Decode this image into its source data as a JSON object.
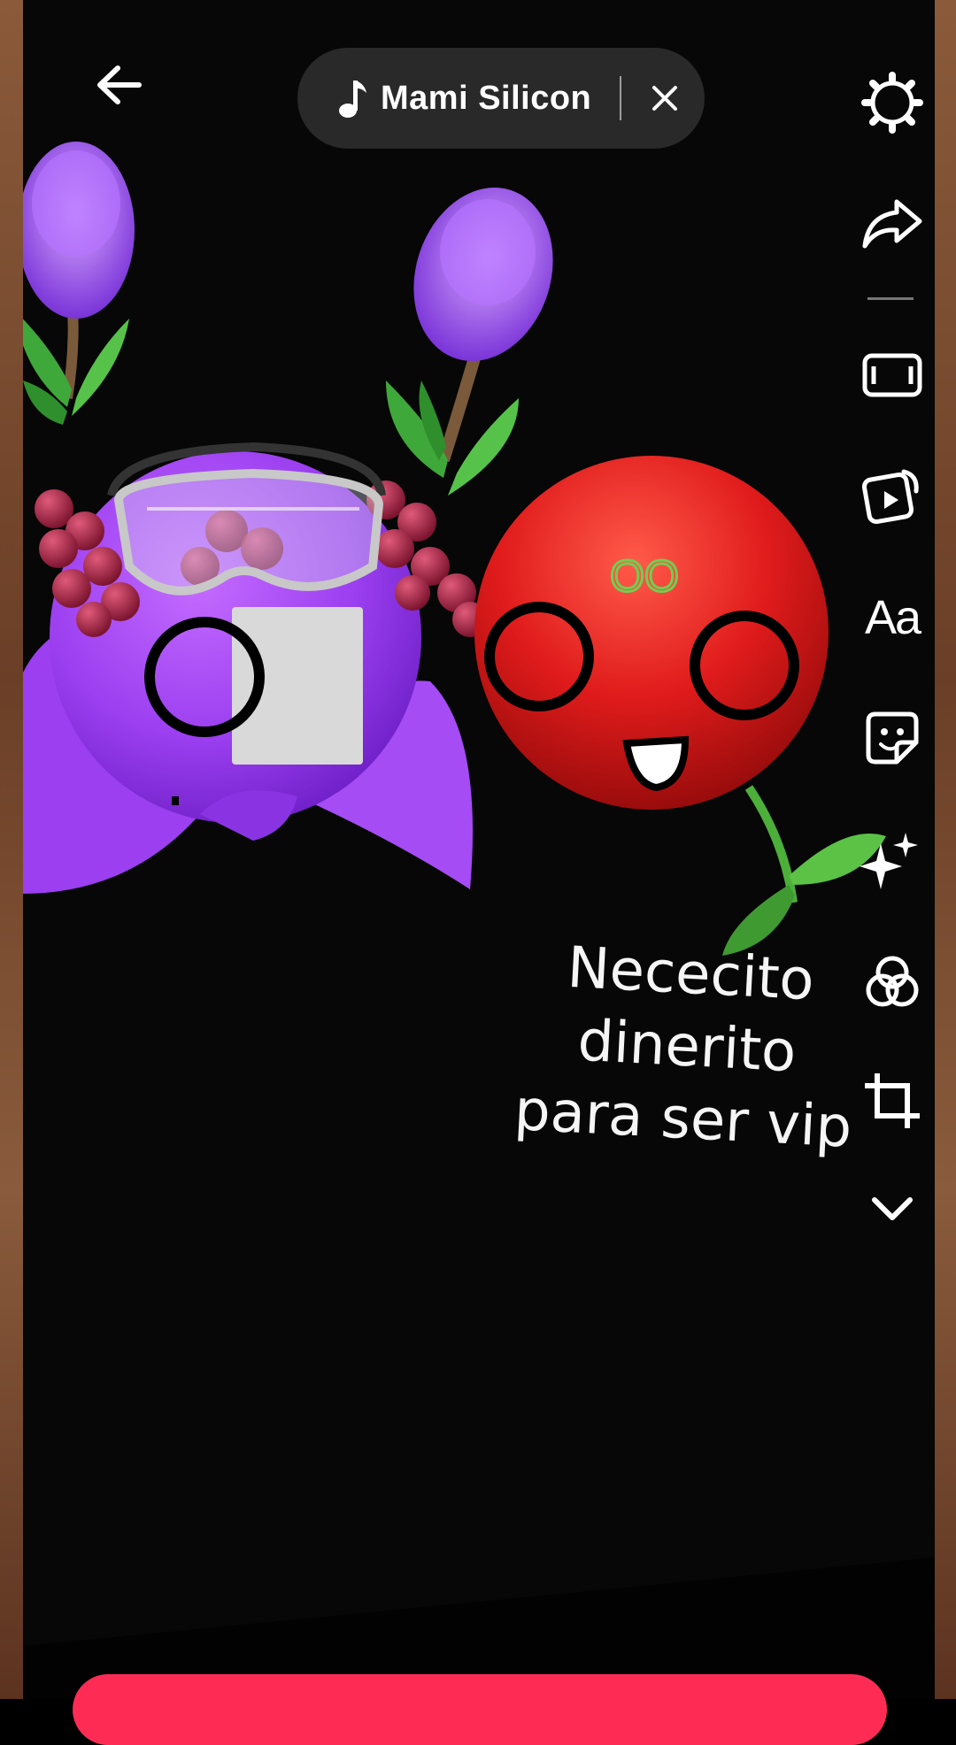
{
  "header": {
    "sound_title": "Mami Silicon"
  },
  "toolbar": {
    "text_tool_label": "Aa",
    "items": [
      "settings-icon",
      "share-arrow-icon",
      "screen-icon",
      "template-icon",
      "text-icon",
      "sticker-icon",
      "effects-icon",
      "filters-icon",
      "crop-icon",
      "chevron-down-icon"
    ]
  },
  "caption": {
    "line1": "Nececito",
    "line2": "dinerito",
    "line3": "para ser vip"
  },
  "stickers": {
    "red_face_label": "OO"
  },
  "colors": {
    "accent": "#fe2c55",
    "purple": "#9b3ff0",
    "red": "#e01b1b"
  }
}
